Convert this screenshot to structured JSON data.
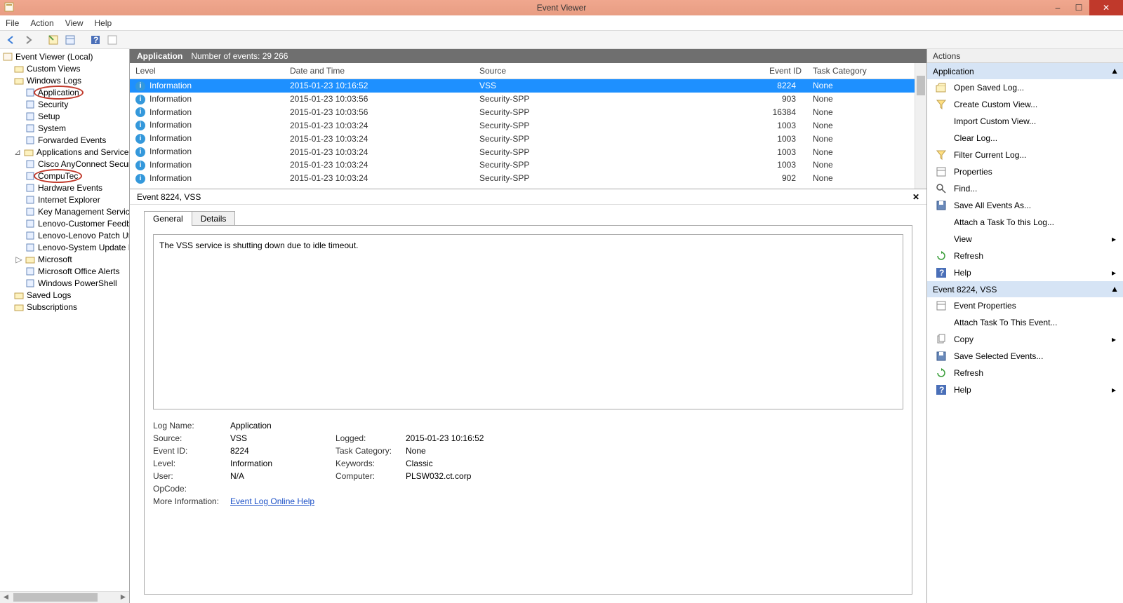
{
  "window": {
    "title": "Event Viewer"
  },
  "menubar": [
    "File",
    "Action",
    "View",
    "Help"
  ],
  "tree": {
    "root": "Event Viewer (Local)",
    "custom_views": "Custom Views",
    "windows_logs": "Windows Logs",
    "wl_items": [
      "Application",
      "Security",
      "Setup",
      "System",
      "Forwarded Events"
    ],
    "apps_logs": "Applications and Services Logs",
    "al_items": [
      "Cisco AnyConnect Secure M",
      "CompuTec",
      "Hardware Events",
      "Internet Explorer",
      "Key Management Service",
      "Lenovo-Customer Feedback",
      "Lenovo-Lenovo Patch Utilit",
      "Lenovo-System Update Pat",
      "Microsoft",
      "Microsoft Office Alerts",
      "Windows PowerShell"
    ],
    "saved_logs": "Saved Logs",
    "subscriptions": "Subscriptions"
  },
  "center_header": {
    "title": "Application",
    "count": "Number of events: 29 266"
  },
  "columns": {
    "level": "Level",
    "date": "Date and Time",
    "source": "Source",
    "eventid": "Event ID",
    "task": "Task Category"
  },
  "events": [
    {
      "level": "Information",
      "date": "2015-01-23 10:16:52",
      "source": "VSS",
      "eventid": "8224",
      "task": "None"
    },
    {
      "level": "Information",
      "date": "2015-01-23 10:03:56",
      "source": "Security-SPP",
      "eventid": "903",
      "task": "None"
    },
    {
      "level": "Information",
      "date": "2015-01-23 10:03:56",
      "source": "Security-SPP",
      "eventid": "16384",
      "task": "None"
    },
    {
      "level": "Information",
      "date": "2015-01-23 10:03:24",
      "source": "Security-SPP",
      "eventid": "1003",
      "task": "None"
    },
    {
      "level": "Information",
      "date": "2015-01-23 10:03:24",
      "source": "Security-SPP",
      "eventid": "1003",
      "task": "None"
    },
    {
      "level": "Information",
      "date": "2015-01-23 10:03:24",
      "source": "Security-SPP",
      "eventid": "1003",
      "task": "None"
    },
    {
      "level": "Information",
      "date": "2015-01-23 10:03:24",
      "source": "Security-SPP",
      "eventid": "1003",
      "task": "None"
    },
    {
      "level": "Information",
      "date": "2015-01-23 10:03:24",
      "source": "Security-SPP",
      "eventid": "902",
      "task": "None"
    }
  ],
  "detail": {
    "title": "Event 8224, VSS",
    "tab_general": "General",
    "tab_details": "Details",
    "message": "The VSS service is shutting down due to idle timeout.",
    "labels": {
      "logname": "Log Name:",
      "source": "Source:",
      "eventid": "Event ID:",
      "level": "Level:",
      "user": "User:",
      "opcode": "OpCode:",
      "moreinfo": "More Information:",
      "logged": "Logged:",
      "task": "Task Category:",
      "keywords": "Keywords:",
      "computer": "Computer:"
    },
    "values": {
      "logname": "Application",
      "source": "VSS",
      "eventid": "8224",
      "level": "Information",
      "user": "N/A",
      "opcode": "",
      "moreinfo": "Event Log Online Help",
      "logged": "2015-01-23 10:16:52",
      "task": "None",
      "keywords": "Classic",
      "computer": "PLSW032.ct.corp"
    }
  },
  "actions": {
    "header": "Actions",
    "group1_title": "Application",
    "group1": [
      "Open Saved Log...",
      "Create Custom View...",
      "Import Custom View...",
      "Clear Log...",
      "Filter Current Log...",
      "Properties",
      "Find...",
      "Save All Events As...",
      "Attach a Task To this Log...",
      "View",
      "Refresh",
      "Help"
    ],
    "group2_title": "Event 8224, VSS",
    "group2": [
      "Event Properties",
      "Attach Task To This Event...",
      "Copy",
      "Save Selected Events...",
      "Refresh",
      "Help"
    ]
  }
}
